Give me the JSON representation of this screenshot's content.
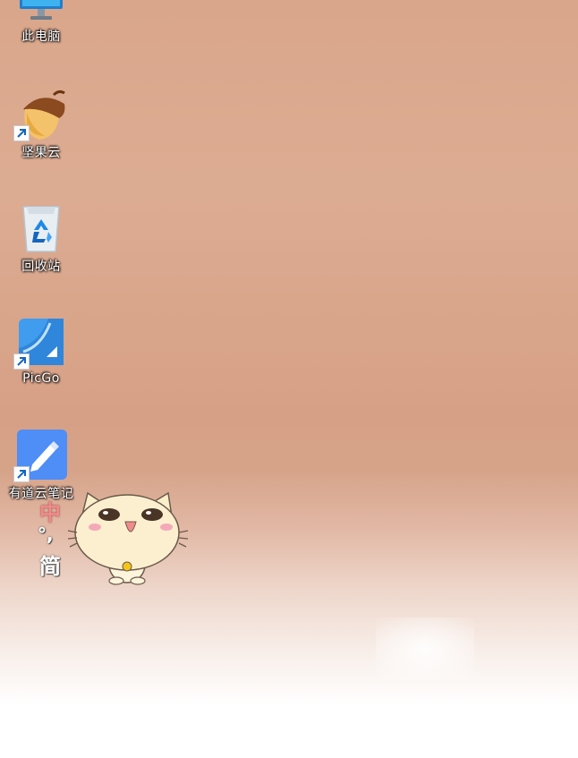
{
  "desktop": {
    "icons": [
      {
        "label": "此电脑",
        "icon": "monitor-icon"
      },
      {
        "label": "坚果云",
        "icon": "acorn-icon"
      },
      {
        "label": "回收站",
        "icon": "recycle-bin-icon"
      },
      {
        "label": "PicGo",
        "icon": "picgo-icon"
      },
      {
        "label": "有道云笔记",
        "icon": "youdao-note-icon"
      }
    ]
  },
  "ime": {
    "mode": "中",
    "punct": "°,",
    "script": "简"
  }
}
